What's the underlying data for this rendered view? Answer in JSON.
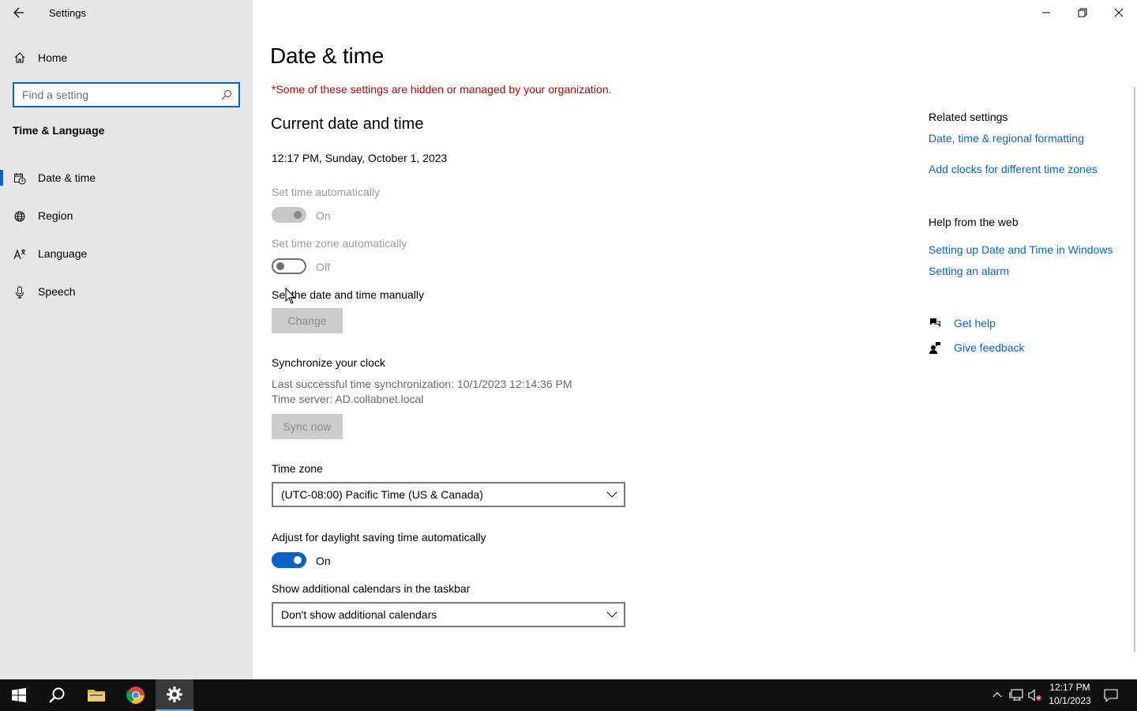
{
  "window": {
    "title": "Settings",
    "controls": {
      "minimize": "minimize-icon",
      "restore": "restore-icon",
      "close": "close-icon"
    }
  },
  "sidebar": {
    "home_label": "Home",
    "search_placeholder": "Find a setting",
    "section_title": "Time & Language",
    "items": [
      {
        "label": "Date & time",
        "icon": "calendar-clock-icon",
        "active": true
      },
      {
        "label": "Region",
        "icon": "globe-icon",
        "active": false
      },
      {
        "label": "Language",
        "icon": "language-icon",
        "active": false
      },
      {
        "label": "Speech",
        "icon": "microphone-icon",
        "active": false
      }
    ]
  },
  "main": {
    "page_title": "Date & time",
    "org_warning": "*Some of these settings are hidden or managed by your organization.",
    "current_heading": "Current date and time",
    "current_datetime": "12:17 PM, Sunday, October 1, 2023",
    "set_time_auto": {
      "label": "Set time automatically",
      "state": "On",
      "on": true,
      "disabled": true
    },
    "set_timezone_auto": {
      "label": "Set time zone automatically",
      "state": "Off",
      "on": false,
      "disabled": true
    },
    "manual": {
      "label": "Set the date and time manually",
      "button": "Change"
    },
    "sync": {
      "heading": "Synchronize your clock",
      "last_sync": "Last successful time synchronization: 10/1/2023 12:14:36 PM",
      "server": "Time server: AD.collabnet.local",
      "button": "Sync now"
    },
    "timezone": {
      "label": "Time zone",
      "selected": "(UTC-08:00) Pacific Time (US & Canada)"
    },
    "dst": {
      "label": "Adjust for daylight saving time automatically",
      "state": "On",
      "on": true
    },
    "calendars": {
      "label": "Show additional calendars in the taskbar",
      "selected": "Don't show additional calendars"
    }
  },
  "related": {
    "heading": "Related settings",
    "links": [
      "Date, time & regional formatting",
      "Add clocks for different time zones"
    ]
  },
  "help_web": {
    "heading": "Help from the web",
    "links": [
      "Setting up Date and Time in Windows",
      "Setting an alarm"
    ]
  },
  "support": {
    "get_help": "Get help",
    "give_feedback": "Give feedback"
  },
  "taskbar": {
    "time": "12:17 PM",
    "date": "10/1/2023",
    "accent": "#0a64c8"
  }
}
